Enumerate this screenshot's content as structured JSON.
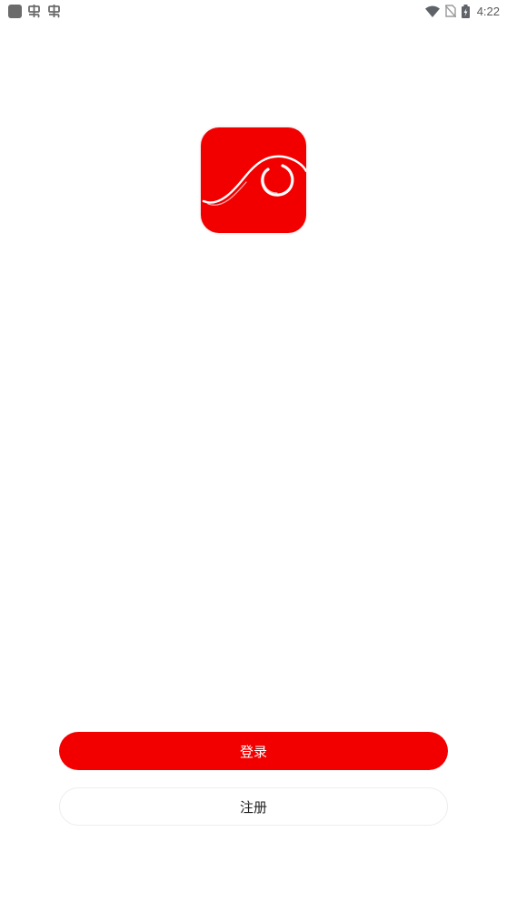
{
  "status_bar": {
    "left_icons": [
      "notification-square-icon",
      "bug-icon",
      "bug-icon"
    ],
    "right_icons": [
      "wifi-icon",
      "no-sim-icon",
      "battery-charging-icon"
    ],
    "time": "4:22"
  },
  "app": {
    "logo_icon": "app-logo-swirl-icon",
    "brand_color": "#f20000"
  },
  "actions": {
    "login_label": "登录",
    "register_label": "注册"
  }
}
